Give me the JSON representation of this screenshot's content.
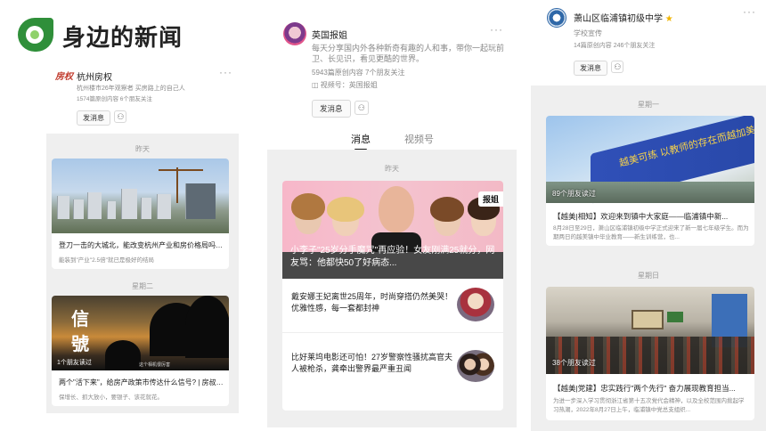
{
  "slide": {
    "title": "身边的新闻"
  },
  "panel1": {
    "account_logo": "房权",
    "account_name": "杭州房权",
    "bio": "杭州楼市26年观察者 买房路上的自己人",
    "stats": "1574篇原创内容 6个朋友关注",
    "message_button": "发消息",
    "day1": "昨天",
    "article1_title": "登刀一击的大城北，能改变杭州产业和房价格局吗? ...",
    "article1_meta": "能装到\"产业\"2.5倍\"就已是极好的结局",
    "day2": "星期二",
    "article2_overlay_chars": [
      "信",
      "號"
    ],
    "article2_friends": "1个朋友读过",
    "article2_watermark": "这个相机很厉害",
    "article2_title": "两个\"活下来\"，给房产政策市传达什么信号? | 房叔说...",
    "article2_meta": "保增长、抓大放小，要银子、该花就花。"
  },
  "panel2": {
    "account_name": "英国报姐",
    "bio": "每天分享国内外各种新奇有趣的人和事，带你一起玩前卫、长见识，看见更酷的世界。",
    "stats": "5943篇原创内容 7个朋友关注",
    "channel": "视频号：英国报姐",
    "message_button": "发消息",
    "tabs": [
      {
        "label": "消息"
      },
      {
        "label": "视频号"
      }
    ],
    "day": "昨天",
    "brand_tag": "报姐",
    "headline": "小李子\"25岁分手魔咒\"再应验！女友刚满25就分，网友骂：他都快50了好病态...",
    "item1_title": "戴安娜王妃离世25周年，时尚穿搭仍然美哭！优雅性感，每一套都封神",
    "item2_title": "比好莱坞电影还可怕！27岁警察性骚扰高官夫人被枪杀，龚牵出警界最严重丑闻"
  },
  "panel3": {
    "account_name": "萧山区临浦镇初级中学",
    "account_type": "学校宣传",
    "stats": "14篇原创内容 246个朋友关注",
    "message_button": "发消息",
    "day1": "星期一",
    "article1_friends": "89个朋友读过",
    "article1_banner_text": "越美可练 以教师的存在而越加美",
    "article1_title": "【越美|相知】欢迎来到镇中大家庭——临浦镇中新...",
    "article1_meta": "8月28日至29日，萧山区临浦镇初级中学正式迎来了新一届七年级学生。而为期两日的越美镇中毕业教育——新生训练营，也...",
    "day2": "星期日",
    "article2_friends": "38个朋友读过",
    "article2_title": "【越美|党建】忠实践行\"两个先行\" 奋力展现教育担当...",
    "article2_meta": "为进一步深入学习贯彻浙江省第十五次党代会精神，以及全校范围内掀起学习热潮，2022年8月27日上午，临浦镇中党总支组织..."
  }
}
